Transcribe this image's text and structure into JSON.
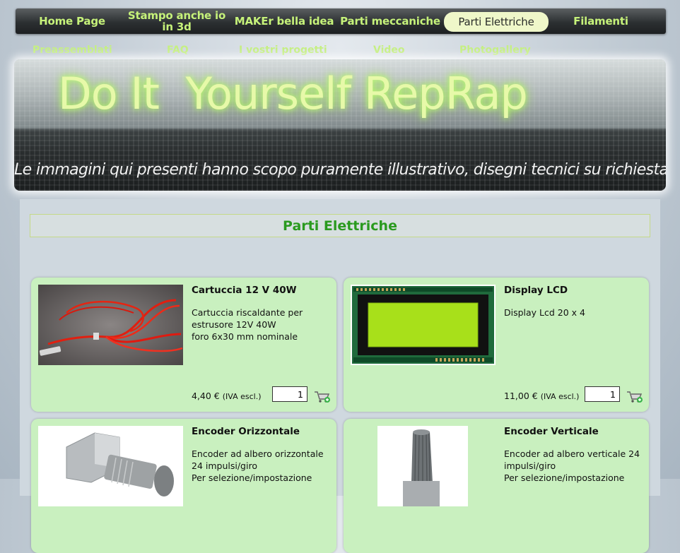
{
  "nav": {
    "row1": [
      "Home Page",
      "Stampo anche io in 3d",
      "MAKEr bella idea",
      "Parti meccaniche",
      "Parti Elettriche",
      "Filamenti"
    ],
    "row2": [
      "Preassemblati",
      "FAQ",
      "I vostri progetti",
      "Video",
      "Photogallery"
    ],
    "active": "Parti Elettriche"
  },
  "banner": {
    "title": "Do It  Yourself RepRap",
    "subtitle": "Le immagini qui presenti hanno scopo puramente illustrativo, disegni tecnici su richiesta"
  },
  "section": {
    "title": "Parti Elettriche"
  },
  "products": [
    {
      "name": "Cartuccia 12 V 40W",
      "description": "Cartuccia riscaldante per\nestrusore 12V 40W\nforo 6x30 mm nominale",
      "price": "4,40 €",
      "tax_note": "(IVA escl.)",
      "quantity": "1",
      "image": "heater-cartridge-photo"
    },
    {
      "name": "Display LCD",
      "description": "Display Lcd 20 x 4",
      "price": "11,00 €",
      "tax_note": "(IVA escl.)",
      "quantity": "1",
      "image": "lcd-display-photo"
    },
    {
      "name": "Encoder Orizzontale",
      "description": "Encoder ad albero orizzontale\n24 impulsi/giro\nPer selezione/impostazione",
      "image": "horizontal-encoder-photo"
    },
    {
      "name": "Encoder Verticale",
      "description": "Encoder ad albero verticale 24\nimpulsi/giro\nPer selezione/impostazione",
      "image": "vertical-encoder-photo"
    }
  ],
  "colors": {
    "nav_text": "#c6f27a",
    "card_bg": "#c9f0bf",
    "section_title": "#2a9a1f"
  }
}
